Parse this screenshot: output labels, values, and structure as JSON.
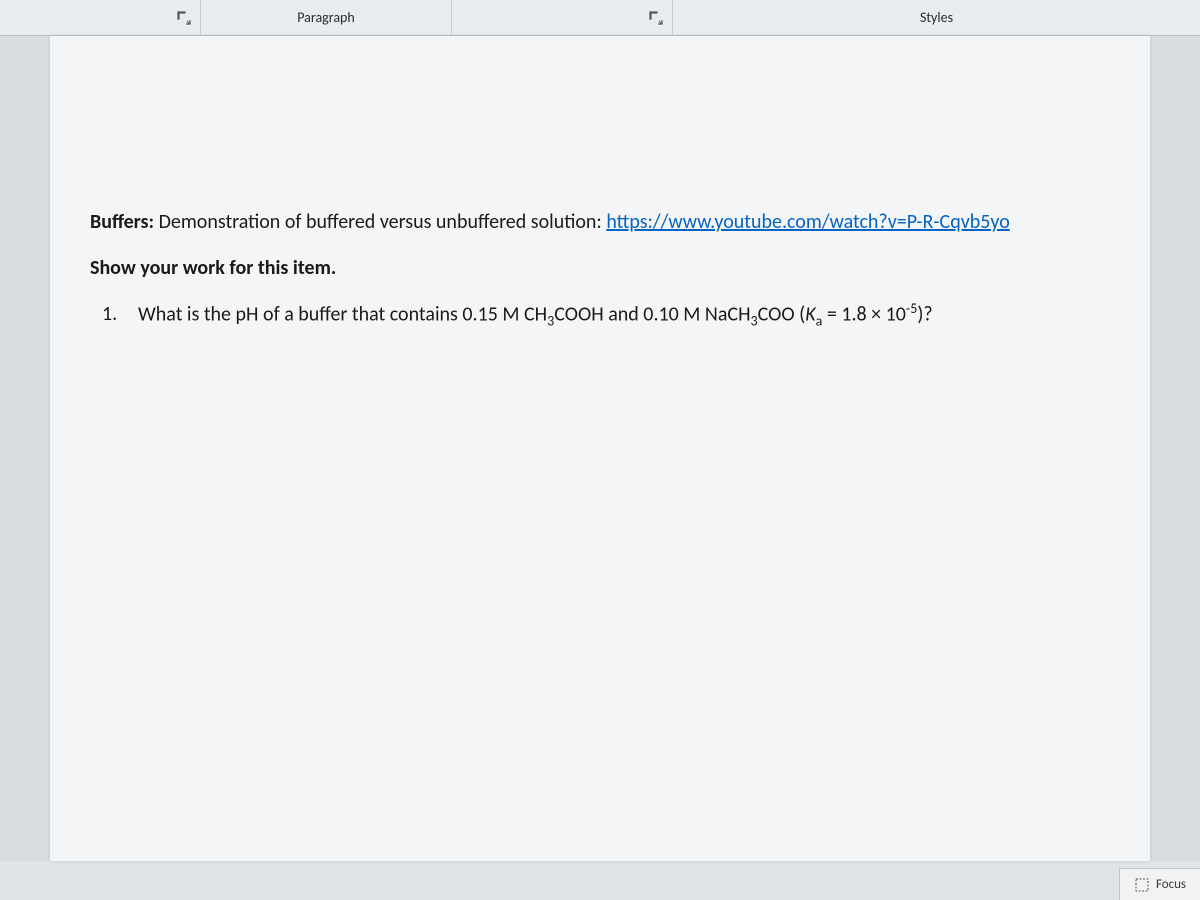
{
  "ribbon": {
    "paragraph_label": "Paragraph",
    "styles_label": "Styles"
  },
  "document": {
    "buffers_label": "Buffers:",
    "demo_text": " Demonstration of buffered versus unbuffered solution: ",
    "link_text": "https://www.youtube.com/watch?v=P-R-Cqvb5yo",
    "instruction": "Show your work for this item.",
    "q1_number": "1.",
    "q1_prefix": "What is the pH of a buffer that contains 0.15 M CH",
    "q1_sub1": "3",
    "q1_mid1": "COOH and 0.10 M NaCH",
    "q1_sub2": "3",
    "q1_mid2": "COO (",
    "q1_k": "K",
    "q1_ksub": "a",
    "q1_eq": " = 1.8 × 10",
    "q1_exp": "-5",
    "q1_end": ")?"
  },
  "status": {
    "focus_label": "Focus"
  }
}
